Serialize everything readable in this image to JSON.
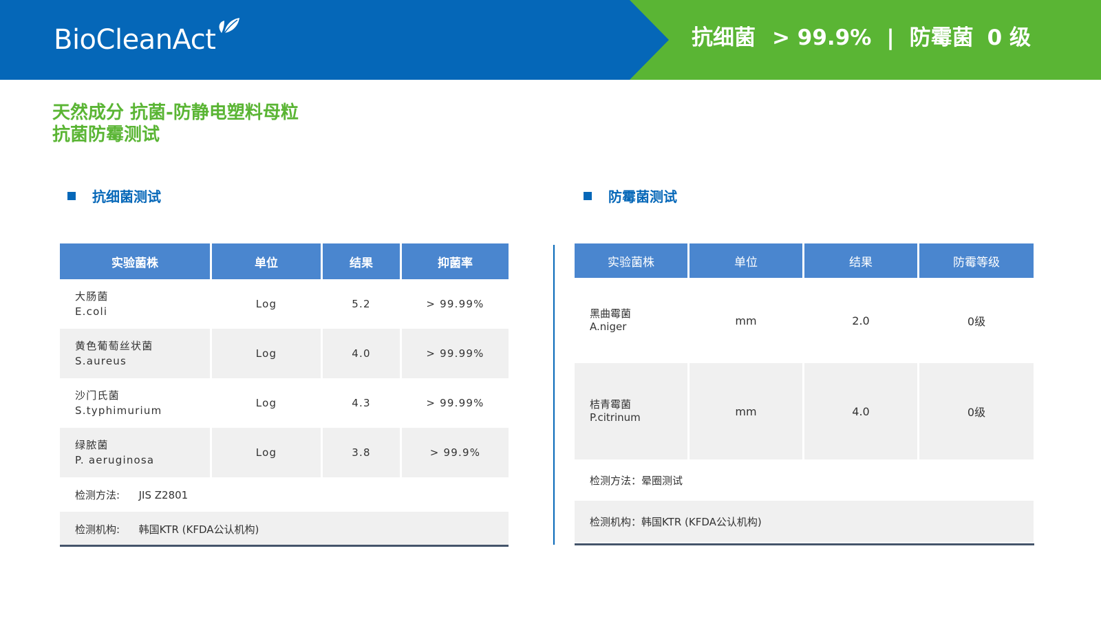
{
  "header": {
    "logo": "BioCleanAct",
    "banner": {
      "antibacterial_label": "抗细菌",
      "antibacterial_value": "> 99.9%",
      "separator": "|",
      "antifungal_label": "防霉菌",
      "antifungal_value": "0 级"
    },
    "colors": {
      "blue": "#0567b8",
      "green": "#5ab534"
    }
  },
  "title": {
    "line1": "天然成分 抗菌-防静电塑料母粒",
    "line2": "抗菌防霉测试"
  },
  "antibacterial": {
    "heading": "抗细菌测试",
    "columns": [
      "实验菌株",
      "单位",
      "结果",
      "抑菌率"
    ],
    "rows": [
      {
        "name_cn": "大肠菌",
        "name_en": "E.coli",
        "unit": "Log",
        "result": "5.2",
        "rate": "> 99.99%"
      },
      {
        "name_cn": "黄色葡萄丝状菌",
        "name_en": "S.aureus",
        "unit": "Log",
        "result": "4.0",
        "rate": "> 99.99%"
      },
      {
        "name_cn": "沙门氏菌",
        "name_en": "S.typhimurium",
        "unit": "Log",
        "result": "4.3",
        "rate": "> 99.99%"
      },
      {
        "name_cn": "绿脓菌",
        "name_en": "P. aeruginosa",
        "unit": "Log",
        "result": "3.8",
        "rate": "> 99.9%"
      }
    ],
    "method_label": "检测方法:",
    "method_value": "JIS Z2801",
    "org_label": "检测机构:",
    "org_value": "韩国KTR (KFDA公认机构)"
  },
  "antifungal": {
    "heading": "防霉菌测试",
    "columns": [
      "实验菌株",
      "单位",
      "结果",
      "防霉等级"
    ],
    "rows": [
      {
        "name_cn": "黑曲霉菌",
        "name_en": "A.niger",
        "unit": "mm",
        "result": "2.0",
        "grade": "0级"
      },
      {
        "name_cn": "桔青霉菌",
        "name_en": "P.citrinum",
        "unit": "mm",
        "result": "4.0",
        "grade": "0级"
      }
    ],
    "method": "检测方法：晕圈测试",
    "org": "检测机构：韩国KTR (KFDA公认机构)"
  }
}
